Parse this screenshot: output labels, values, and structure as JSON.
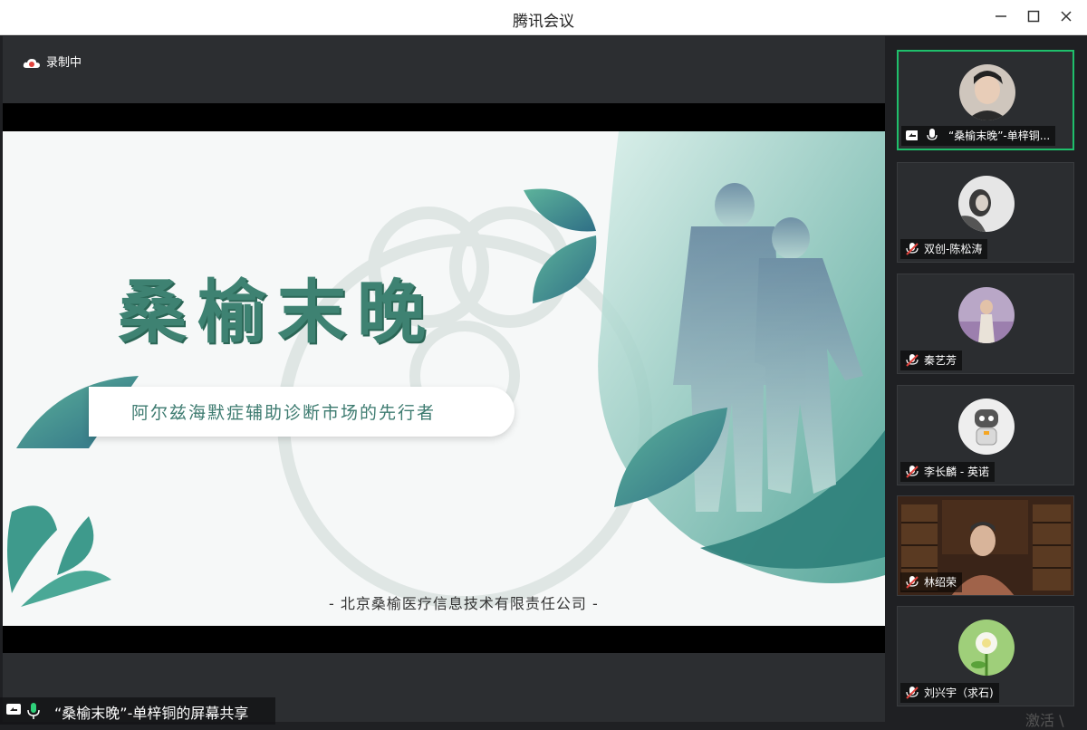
{
  "window": {
    "title": "腾讯会议"
  },
  "recording": {
    "label": "录制中"
  },
  "slide": {
    "title": "桑榆末晚",
    "subtitle": "阿尔兹海默症辅助诊断市场的先行者",
    "company": "- 北京桑榆医疗信息技术有限责任公司 -"
  },
  "share_status": {
    "label": "“桑榆末晚”-单梓铜的屏幕共享"
  },
  "participants": [
    {
      "name": "“桑榆末晚”-单梓铜...",
      "muted": false,
      "sharing": true
    },
    {
      "name": "双创-陈松涛",
      "muted": true
    },
    {
      "name": "秦艺芳",
      "muted": true
    },
    {
      "name": "李长麟 - 英诺",
      "muted": true
    },
    {
      "name": "林绍荣",
      "muted": true
    },
    {
      "name": "刘兴宇（求石)",
      "muted": true
    }
  ],
  "watermark": "激活 \\",
  "colors": {
    "active_border": "#1fbf6b",
    "slide_green": "#3e8272",
    "mute_red": "#e0433d"
  }
}
